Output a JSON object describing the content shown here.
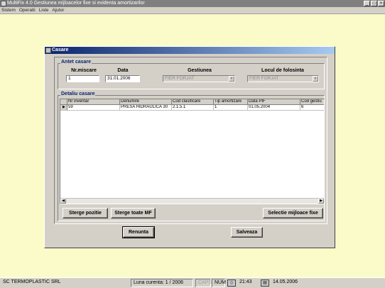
{
  "app": {
    "title": "MultiFix 4.0    Gestiunea mijloacelor fixe si evidenta amortizarilor",
    "window_buttons": [
      "_",
      "□",
      "×"
    ]
  },
  "menu": [
    "Sistem",
    "Operatii",
    "Liste",
    "Ajutor"
  ],
  "dialog": {
    "title": "Casare",
    "header_group": {
      "label": "Antet casare",
      "nr_label": "Nr.miscare",
      "nr_value": "1",
      "data_label": "Data",
      "data_value": "31.01.2006",
      "gestiunea_label": "Gestiunea",
      "gestiunea_value": "FIER FORJAT",
      "locul_label": "Locul de folosinta",
      "locul_value": "FIER FORJAT"
    },
    "detail_group": {
      "label": "Detaliu casare",
      "columns": [
        "Nr inventar",
        "Denumire",
        "Cod clasificare",
        "Tip amortizare",
        "Data PIF",
        "Cod gestiu"
      ],
      "rows": [
        [
          "59",
          "PRESA HIDRAULICA 30",
          "2.1.5.1",
          "1",
          "01.05.2004",
          "6"
        ]
      ]
    },
    "buttons": {
      "sterge_pozitie": "Sterge pozitie",
      "sterge_toate": "Sterge toate MF",
      "selectie": "Selectie mijloace fixe",
      "renunta": "Renunta",
      "salveaza": "Salveaza"
    }
  },
  "statusbar": {
    "company": "SC TERMOPLASTIC SRL",
    "luna": "Luna curenta: 1 / 2006",
    "caps": "CAPS",
    "num": "NUM",
    "time": "21:43",
    "date": "14.05.2006"
  }
}
